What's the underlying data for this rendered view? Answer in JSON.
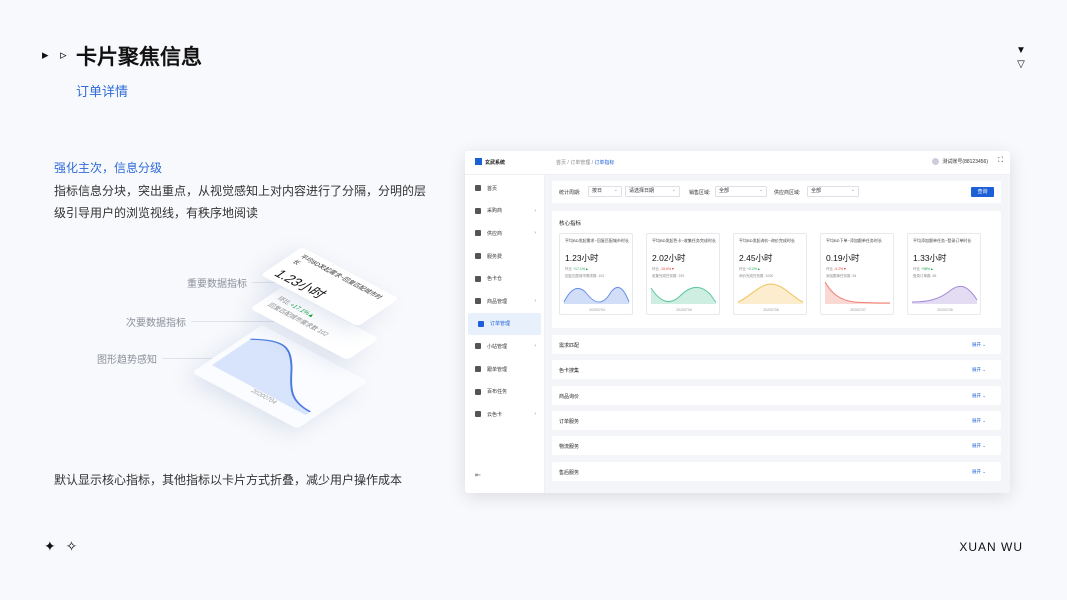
{
  "header": {
    "title": "卡片聚焦信息",
    "subtitle": "订单详情",
    "arrows": "▸ ▹"
  },
  "left": {
    "heading": "强化主次，信息分级",
    "body": "指标信息分块，突出重点，从视觉感知上对内容进行了分隔，分明的层级引导用户的浏览视线，有秩序地阅读",
    "footer": "默认显示核心指标，其他指标以卡片方式折叠，减少用户操作成本"
  },
  "illustration": {
    "label_primary": "重要数据指标",
    "label_secondary": "次要数据指标",
    "label_trend": "图形趋势感知",
    "card_title": "平均BD发起需求~回复匹配城市时长",
    "card_value": "1.23小时",
    "card_compare": "环比",
    "card_compare_val": "+17.1%▲",
    "card_detail": "回复匹配城市需求数",
    "card_detail_val": "102",
    "card_date": "20200704"
  },
  "footer": {
    "stars": "✦ ✧",
    "brand": "XUAN WU"
  },
  "app": {
    "brand": "玄武系统",
    "breadcrumb_1": "首页",
    "breadcrumb_2": "订单管理",
    "breadcrumb_3": "订单指标",
    "user": "测试账号(88123456)",
    "sidebar": [
      {
        "label": "首页",
        "arrow": ""
      },
      {
        "label": "采购商",
        "arrow": "›"
      },
      {
        "label": "供应商",
        "arrow": "›"
      },
      {
        "label": "服务费",
        "arrow": ""
      },
      {
        "label": "色卡仓",
        "arrow": ""
      },
      {
        "label": "商品管理",
        "arrow": "›"
      },
      {
        "label": "订单管理",
        "arrow": ""
      },
      {
        "label": "小站管理",
        "arrow": "›"
      },
      {
        "label": "跟单管理",
        "arrow": ""
      },
      {
        "label": "百布任务",
        "arrow": ""
      },
      {
        "label": "云色卡",
        "arrow": "›"
      }
    ],
    "filter": {
      "period_label": "统计周期:",
      "period_value": "按日",
      "date_placeholder": "请选择日期",
      "sales_label": "销售区域:",
      "sales_value": "全部",
      "supply_label": "供应商区域:",
      "supply_value": "全部",
      "query": "查询"
    },
    "core_title": "核心指标",
    "kpis": [
      {
        "title": "平均BD发起需求~回复匹配城市时长",
        "value": "1.23小时",
        "cmp": "环比",
        "delta": "+17.1%▲",
        "delta_color": "#1aa34a",
        "detail": "回复匹配城市需求数",
        "count": "102",
        "date": "20200704",
        "color": "#6a93e8"
      },
      {
        "title": "平均BD发起色卡~收集任务完成时长",
        "value": "2.02小时",
        "cmp": "环比",
        "delta": "-15.6%▼",
        "delta_color": "#e2453c",
        "detail": "收集完成任务数",
        "count": "229",
        "date": "20200706",
        "color": "#5ec6a0"
      },
      {
        "title": "平均BD发起询价~询价完成时长",
        "value": "2.45小时",
        "cmp": "环比",
        "delta": "+2.2%▲",
        "delta_color": "#1aa34a",
        "detail": "询价完成任务数",
        "count": "1000",
        "date": "20200706",
        "color": "#f2c25a"
      },
      {
        "title": "平均BD下单~添加跟单任务时长",
        "value": "0.19小时",
        "cmp": "环比",
        "delta": "-9.2%▼",
        "delta_color": "#e2453c",
        "detail": "添加跟单任务数",
        "count": "54",
        "date": "20200707",
        "color": "#ef7e6f"
      },
      {
        "title": "平均添加跟单任务~登录订单时长",
        "value": "1.33小时",
        "cmp": "环比",
        "delta": "+38%▲",
        "delta_color": "#1aa34a",
        "detail": "登录订单数",
        "count": "65",
        "date": "20200706",
        "color": "#a48ad8"
      }
    ],
    "sections": [
      {
        "title": "需求匹配",
        "action": "展开 ⌄"
      },
      {
        "title": "色卡搜集",
        "action": "展开 ⌄"
      },
      {
        "title": "商品询价",
        "action": "展开 ⌄"
      },
      {
        "title": "订单服务",
        "action": "展开 ⌄"
      },
      {
        "title": "物流服务",
        "action": "展开 ⌄"
      },
      {
        "title": "售后服务",
        "action": "展开 ⌄"
      }
    ]
  }
}
